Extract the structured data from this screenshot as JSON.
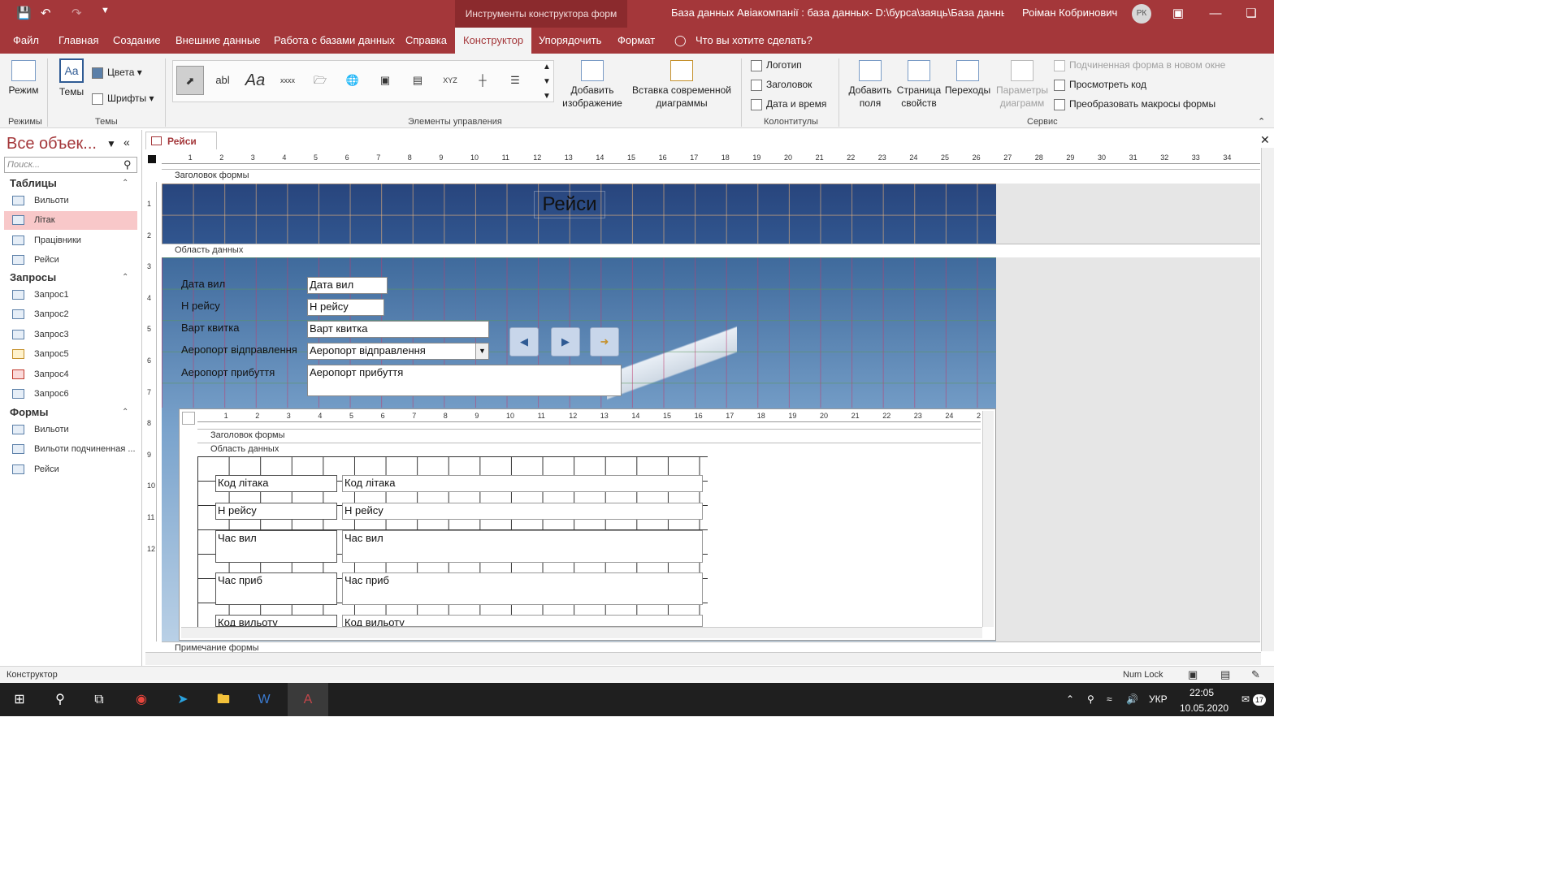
{
  "titlebar": {
    "context_title": "Инструменты конструктора форм",
    "doc_title": "База данных Авіакомпанії : база данных- D:\\бурса\\заяць\\База данных А...",
    "user": "Роіман Кобринович",
    "avatar": "РК"
  },
  "tabs": [
    "Файл",
    "Главная",
    "Создание",
    "Внешние данные",
    "Работа с базами данных",
    "Справка",
    "Конструктор",
    "Упорядочить",
    "Формат"
  ],
  "tell_me": "Что вы хотите сделать?",
  "ribbon": {
    "modes_label": "Режим",
    "modes_group": "Режимы",
    "themes_label": "Темы",
    "colors_label": "Цвета",
    "fonts_label": "Шрифты",
    "themes_group": "Темы",
    "controls_group": "Элементы управления",
    "add_image": "Добавить изображение",
    "insert_chart": "Вставка современной диаграммы",
    "logo": "Логотип",
    "header": "Заголовок",
    "datetime": "Дата и время",
    "header_group": "Колонтитулы",
    "add_fields": "Добавить поля",
    "property_sheet": "Страница свойств",
    "tab_order": "Переходы",
    "chart_params": "Параметры диаграмм",
    "subform_window": "Подчиненная форма в новом окне",
    "view_code": "Просмотреть код",
    "convert_macros": "Преобразовать макросы формы",
    "service_group": "Сервис"
  },
  "nav": {
    "title": "Все объек...",
    "search_placeholder": "Поиск...",
    "tables_header": "Таблицы",
    "tables": [
      "Вильоти",
      "Літак",
      "Працівники",
      "Рейси"
    ],
    "queries_header": "Запросы",
    "queries": [
      "Запрос1",
      "Запрос2",
      "Запрос3",
      "Запрос5",
      "Запрос4",
      "Запрос6"
    ],
    "forms_header": "Формы",
    "forms": [
      "Вильоти",
      "Вильоти подчиненная ...",
      "Рейси"
    ]
  },
  "document": {
    "tab": "Рейси",
    "form_header_section": "Заголовок формы",
    "detail_section": "Область данных",
    "footer_section": "Примечание формы",
    "form_title": "Рейси",
    "fields": [
      {
        "label": "Дата вил",
        "value": "Дата вил"
      },
      {
        "label": "Н рейсу",
        "value": "Н рейсу"
      },
      {
        "label": "Варт квитка",
        "value": "Варт квитка"
      },
      {
        "label": "Аеропорт відправлення",
        "value": "Аеропорт відправлення"
      },
      {
        "label": "Аеропорт прибуття",
        "value": "Аеропорт прибуття"
      }
    ],
    "subform": {
      "header_section": "Заголовок формы",
      "detail_section": "Область данных",
      "fields": [
        {
          "label": "Код літака",
          "value": "Код літака"
        },
        {
          "label": "Н рейсу",
          "value": "Н рейсу"
        },
        {
          "label": "Час вил",
          "value": "Час вил"
        },
        {
          "label": "Час приб",
          "value": "Час приб"
        },
        {
          "label": "Код вильоту",
          "value": "Код вильоту"
        }
      ]
    },
    "ruler_numbers": [
      "1",
      "2",
      "3",
      "4",
      "5",
      "6",
      "7",
      "8",
      "9",
      "10",
      "11",
      "12",
      "13",
      "14",
      "15",
      "16",
      "17",
      "18",
      "19",
      "20",
      "21",
      "22",
      "23",
      "24",
      "25",
      "26",
      "27",
      "28",
      "29",
      "30",
      "31",
      "32",
      "33",
      "34"
    ],
    "vruler_numbers": [
      "1",
      "2",
      "3",
      "4",
      "5",
      "6",
      "7",
      "8",
      "9",
      "10",
      "11",
      "12"
    ]
  },
  "status": {
    "mode": "Конструктор",
    "numlock": "Num Lock"
  },
  "taskbar": {
    "lang": "УКР",
    "time": "22:05",
    "date": "10.05.2020",
    "notif": "17"
  }
}
